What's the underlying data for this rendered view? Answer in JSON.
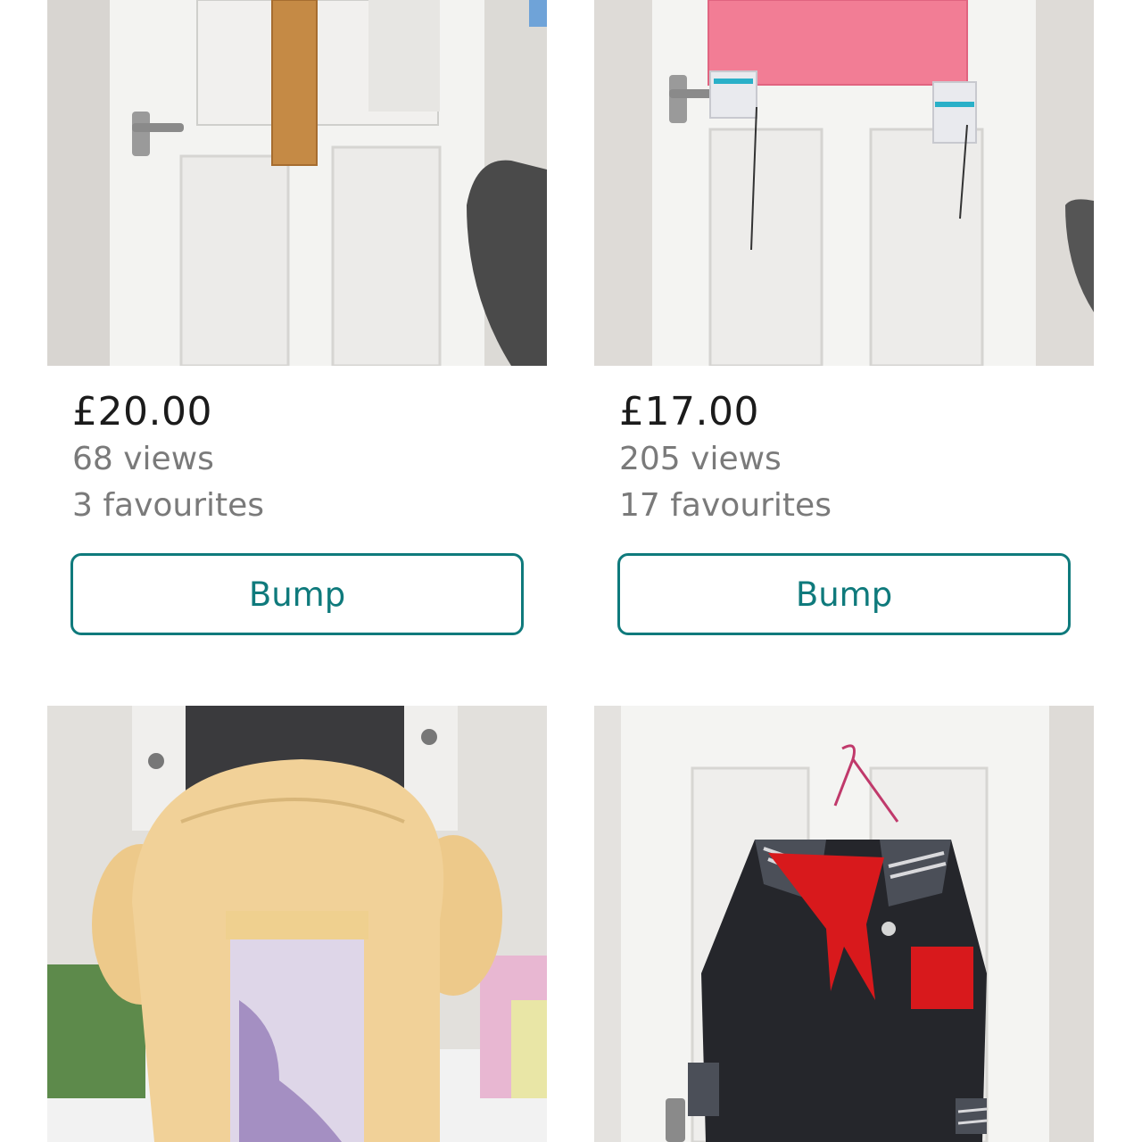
{
  "listings": [
    {
      "price": "£20.00",
      "views": "68 views",
      "favourites": "3 favourites",
      "action_label": "Bump"
    },
    {
      "price": "£17.00",
      "views": "205 views",
      "favourites": "17 favourites",
      "action_label": "Bump"
    },
    {},
    {}
  ],
  "colors": {
    "accent": "#0f7a7c",
    "price_text": "#1b1b1b",
    "meta_text": "#7a7a7a"
  }
}
